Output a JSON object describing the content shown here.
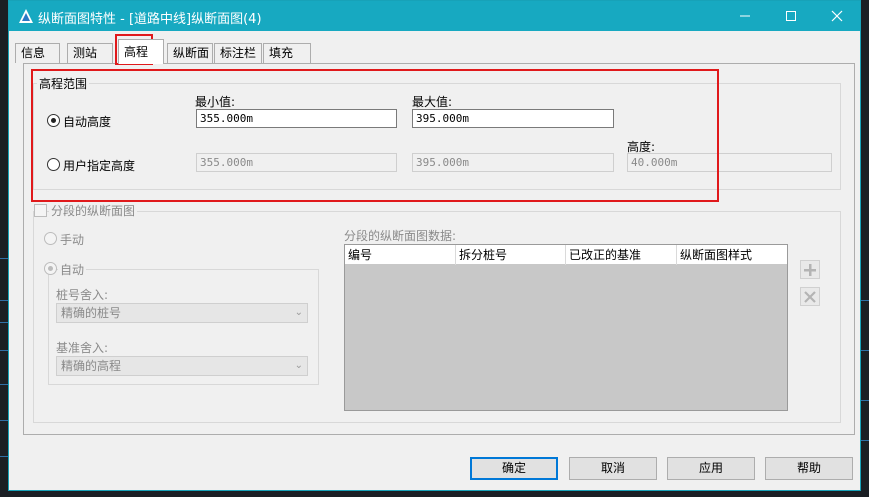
{
  "window": {
    "title": "纵断面图特性 - [道路中线]纵断面图(4)",
    "accent_color": "#17a9c1"
  },
  "tabs": [
    {
      "label": "信息"
    },
    {
      "label": "测站"
    },
    {
      "label": "高程",
      "active": true
    },
    {
      "label": "纵断面"
    },
    {
      "label": "标注栏"
    },
    {
      "label": "填充"
    }
  ],
  "elevation_range": {
    "group_title": "高程范围",
    "min_label": "最小值:",
    "max_label": "最大值:",
    "height_label": "高度:",
    "auto_height": {
      "label": "自动高度",
      "checked": true,
      "min_value": "355.000m",
      "max_value": "395.000m"
    },
    "user_height": {
      "label": "用户指定高度",
      "checked": false,
      "min_value": "355.000m",
      "max_value": "395.000m",
      "height_value": "40.000m"
    }
  },
  "split_view": {
    "checkbox_label": "分段的纵断面图",
    "manual_label": "手动",
    "auto_label": "自动",
    "station_rounding_label": "桩号舍入:",
    "station_rounding_value": "精确的桩号",
    "datum_rounding_label": "基准舍入:",
    "datum_rounding_value": "精确的高程",
    "data_label": "分段的纵断面图数据:",
    "columns": [
      "编号",
      "拆分桩号",
      "已改正的基准",
      "纵断面图样式"
    ]
  },
  "buttons": {
    "ok": "确定",
    "cancel": "取消",
    "apply": "应用",
    "help": "帮助"
  }
}
